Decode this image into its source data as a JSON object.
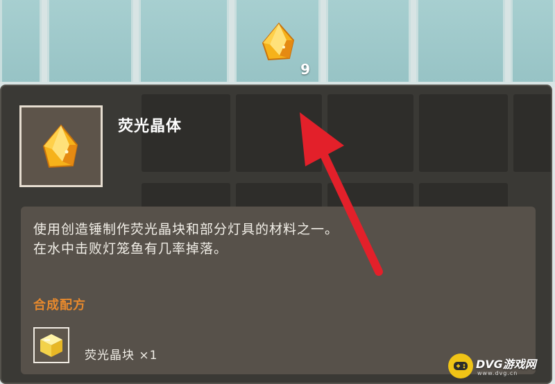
{
  "inventory": {
    "highlighted_slot_count": "9"
  },
  "tooltip": {
    "item_name": "荧光晶体",
    "description_lines": [
      "使用创造锤制作荧光晶块和部分灯具的材料之一。",
      "在水中击败灯笼鱼有几率掉落。"
    ],
    "recipe_title": "合成配方",
    "recipe_result": "荧光晶块 ×1"
  },
  "colors": {
    "panel": "#3a3935",
    "recipe_title": "#e7892d",
    "arrow": "#e3202a",
    "slot": "#a7cfd0"
  },
  "watermark": {
    "brand": "DVG游戏网",
    "url": "www.dvg.cn"
  }
}
